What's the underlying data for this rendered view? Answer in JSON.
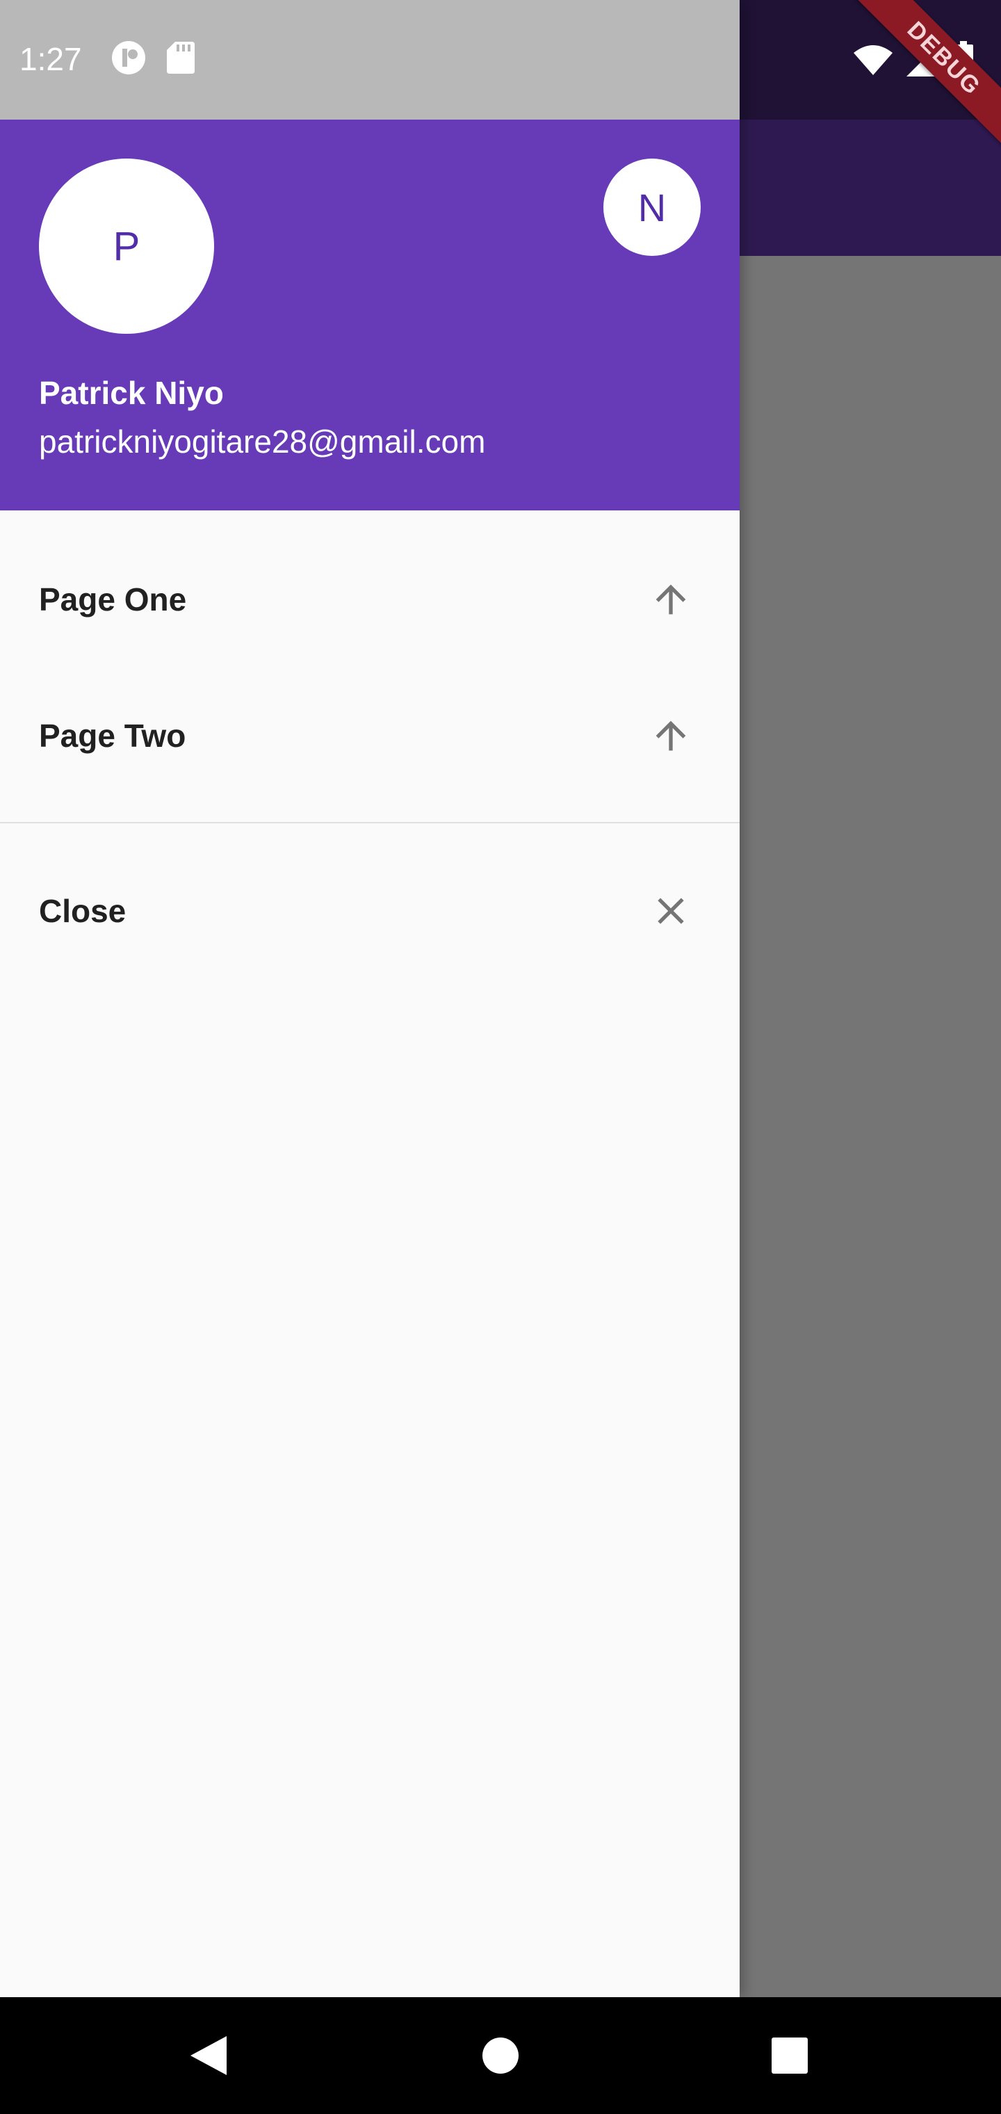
{
  "status_bar": {
    "time": "1:27",
    "left_icons": [
      "notification-app-icon",
      "sd-card-icon"
    ],
    "right_icons": [
      "wifi-icon",
      "cell-signal-icon",
      "battery-icon"
    ]
  },
  "debug_banner": {
    "label": "DEBUG",
    "color": "#8b1a24"
  },
  "drawer": {
    "header": {
      "background_color": "#673ab7",
      "avatar_initial": "P",
      "secondary_avatar_initial": "N",
      "account_name": "Patrick Niyo",
      "account_email": "patrickniyogitare28@gmail.com"
    },
    "items": [
      {
        "label": "Page One",
        "icon": "arrow-upward-icon"
      },
      {
        "label": "Page Two",
        "icon": "arrow-upward-icon"
      }
    ],
    "footer_item": {
      "label": "Close",
      "icon": "close-icon"
    }
  },
  "nav_bar": {
    "buttons": [
      "back-icon",
      "home-icon",
      "recents-icon"
    ]
  }
}
